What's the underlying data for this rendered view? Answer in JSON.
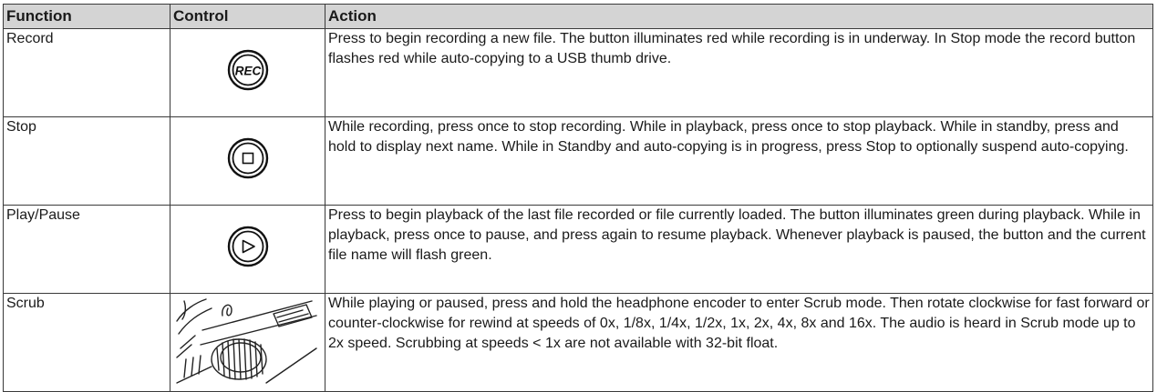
{
  "headers": {
    "function": "Function",
    "control": "Control",
    "action": "Action"
  },
  "rows": [
    {
      "function": "Record",
      "control_icon": "rec-button-icon",
      "control_label": "REC",
      "action": "Press to begin recording a new file. The button illuminates red while recording is in underway. In Stop mode the record button flashes red while auto-copying to a USB thumb drive."
    },
    {
      "function": "Stop",
      "control_icon": "stop-button-icon",
      "action": "While recording, press once to stop recording. While in playback, press once to stop playback. While in standby, press and hold to display next name. While in Standby and auto-copying is in progress, press Stop to optionally suspend auto-copying."
    },
    {
      "function": "Play/Pause",
      "control_icon": "play-button-icon",
      "action": "Press to begin playback of the last file recorded or file currently loaded. The button illuminates green during playback. While in playback, press once to pause, and press again to resume playback. Whenever playback is paused, the button and the current file name will flash green."
    },
    {
      "function": "Scrub",
      "control_icon": "headphone-encoder-illustration-icon",
      "action": "While playing or paused, press and hold the headphone encoder to enter Scrub mode. Then rotate clockwise for fast forward or counter-clockwise for rewind at speeds of 0x, 1/8x, 1/4x, 1/2x, 1x, 2x, 4x, 8x and 16x. The audio is heard in Scrub mode up to 2x speed. Scrubbing at speeds < 1x are not available with 32-bit float."
    }
  ]
}
